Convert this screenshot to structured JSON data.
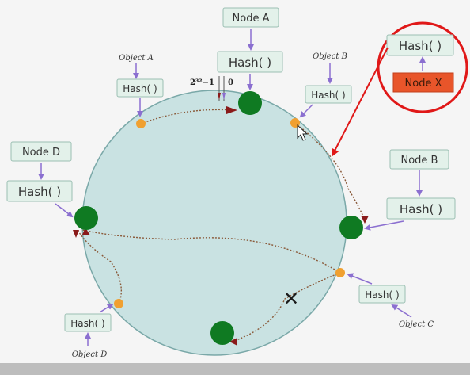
{
  "nodes": {
    "a": {
      "label": "Node A",
      "hash": "Hash( )"
    },
    "b": {
      "label": "Node B",
      "hash": "Hash( )"
    },
    "d": {
      "label": "Node D",
      "hash": "Hash( )"
    },
    "x": {
      "label": "Node X",
      "hash": "Hash( )"
    }
  },
  "objects": {
    "a": {
      "label": "Object A",
      "hash": "Hash( )"
    },
    "b": {
      "label": "Object B",
      "hash": "Hash( )"
    },
    "c": {
      "label": "Object C",
      "hash": "Hash( )"
    },
    "d": {
      "label": "Object D",
      "hash": "Hash( )"
    }
  },
  "ring_labels": {
    "max": "2³²−1",
    "zero": "0"
  },
  "removed_mark": "✕",
  "colors": {
    "ring_fill": "#c9e2e2",
    "node_fill": "#0f7a22",
    "object_fill": "#f0a030",
    "box_fill": "#e3f1ea",
    "box_stroke": "#9bbfb3",
    "arrow_purple": "#8b6fd0",
    "path_dotted": "#8a5a3a",
    "highlight_red": "#e01818",
    "node_x_fill": "#e8552a"
  }
}
